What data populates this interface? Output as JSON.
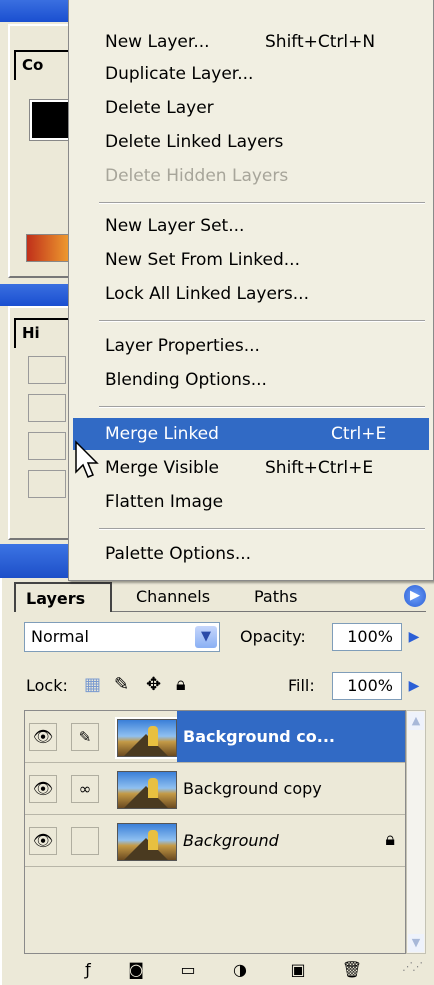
{
  "menu": {
    "items": [
      {
        "label": "New Layer...",
        "shortcut": "Shift+Ctrl+N",
        "state": "normal"
      },
      {
        "label": "Duplicate Layer...",
        "shortcut": "",
        "state": "normal"
      },
      {
        "label": "Delete Layer",
        "shortcut": "",
        "state": "normal"
      },
      {
        "label": "Delete Linked Layers",
        "shortcut": "",
        "state": "normal"
      },
      {
        "label": "Delete Hidden Layers",
        "shortcut": "",
        "state": "disabled"
      },
      {
        "label": "New Layer Set...",
        "shortcut": "",
        "state": "normal"
      },
      {
        "label": "New Set From Linked...",
        "shortcut": "",
        "state": "normal"
      },
      {
        "label": "Lock All Linked Layers...",
        "shortcut": "",
        "state": "normal"
      },
      {
        "label": "Layer Properties...",
        "shortcut": "",
        "state": "normal"
      },
      {
        "label": "Blending Options...",
        "shortcut": "",
        "state": "normal"
      },
      {
        "label": "Merge Linked",
        "shortcut": "Ctrl+E",
        "state": "highlighted"
      },
      {
        "label": "Merge Visible",
        "shortcut": "Shift+Ctrl+E",
        "state": "normal"
      },
      {
        "label": "Flatten Image",
        "shortcut": "",
        "state": "normal"
      },
      {
        "label": "Palette Options...",
        "shortcut": "",
        "state": "normal"
      }
    ]
  },
  "background_palettes": {
    "color_tab": "Co",
    "history_tab": "Hi"
  },
  "layers_palette": {
    "tabs": [
      "Layers",
      "Channels",
      "Paths"
    ],
    "active_tab": "Layers",
    "blend_mode": "Normal",
    "opacity_label": "Opacity:",
    "opacity_value": "100%",
    "lock_label": "Lock:",
    "fill_label": "Fill:",
    "fill_value": "100%",
    "layers": [
      {
        "name": "Background co...",
        "selected": true,
        "link_icon": "brush-icon",
        "italic": false,
        "locked": false
      },
      {
        "name": "Background copy",
        "selected": false,
        "link_icon": "chain-link-icon",
        "italic": false,
        "locked": false
      },
      {
        "name": "Background",
        "selected": false,
        "link_icon": "",
        "italic": true,
        "locked": true
      }
    ]
  },
  "colors": {
    "highlight": "#316ac5",
    "title_bar": "#1d4fc8",
    "panel_bg": "#ece9d8",
    "disabled_text": "#a7a59a"
  }
}
